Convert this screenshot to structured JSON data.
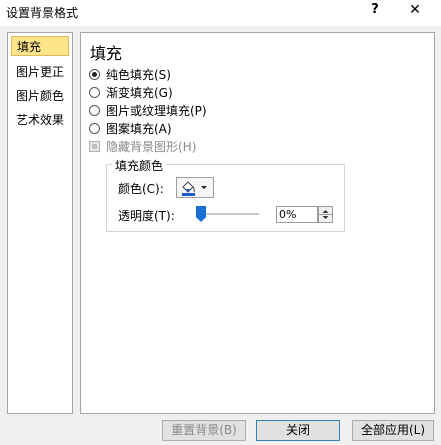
{
  "window": {
    "title": "设置背景格式",
    "help_label": "?",
    "close_label": "✕"
  },
  "sidebar": {
    "items": [
      {
        "label": "填充",
        "active": true
      },
      {
        "label": "图片更正",
        "active": false
      },
      {
        "label": "图片颜色",
        "active": false
      },
      {
        "label": "艺术效果",
        "active": false
      }
    ]
  },
  "fill": {
    "title": "填充",
    "options": [
      {
        "label": "纯色填充(S)",
        "selected": true
      },
      {
        "label": "渐变填充(G)",
        "selected": false
      },
      {
        "label": "图片或纹理填充(P)",
        "selected": false
      },
      {
        "label": "图案填充(A)",
        "selected": false
      }
    ],
    "hide_bg_label": "隐藏背景图形(H)",
    "group_title": "填充颜色",
    "color_label": "颜色(C):",
    "color_icon": "paint-bucket-icon",
    "transparency_label": "透明度(T):",
    "transparency_value": "0%",
    "transparency_fraction": 0
  },
  "footer": {
    "reset_label": "重置背景(B)",
    "close_label": "关闭",
    "apply_all_label": "全部应用(L)"
  },
  "colors": {
    "active_tab_bg": "#fde38a",
    "slider_thumb": "#1a6fd6",
    "fill_swatch": "#1e5ec8"
  }
}
